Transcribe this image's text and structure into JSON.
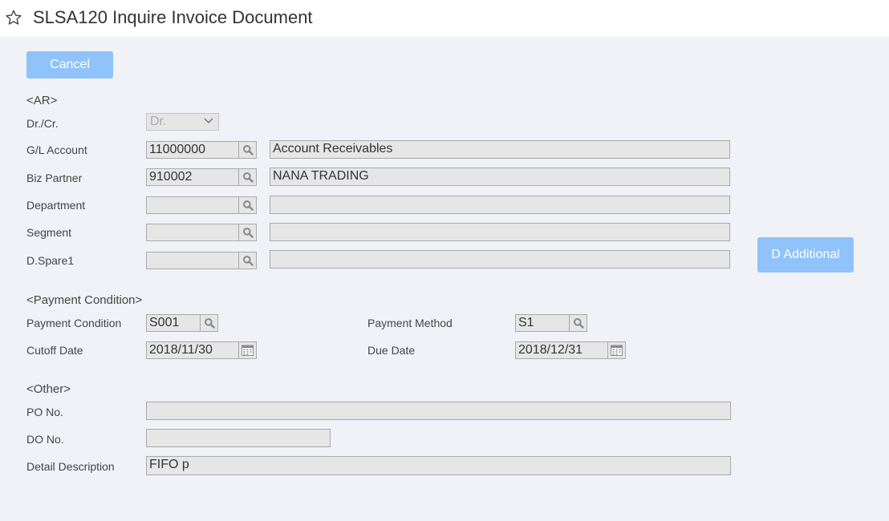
{
  "header": {
    "title": "SLSA120 Inquire Invoice Document"
  },
  "buttons": {
    "cancel": "Cancel",
    "d_additional": "D Additional"
  },
  "sections": {
    "ar": "<AR>",
    "payment": "<Payment Condition>",
    "other": "<Other>"
  },
  "ar": {
    "drcr_label": "Dr./Cr.",
    "drcr_value": "Dr.",
    "gl_label": "G/L Account",
    "gl_code": "11000000",
    "gl_name": "Account Receivables",
    "bp_label": "Biz Partner",
    "bp_code": "910002",
    "bp_name": "NANA TRADING",
    "dept_label": "Department",
    "dept_code": "",
    "dept_name": "",
    "seg_label": "Segment",
    "seg_code": "",
    "seg_name": "",
    "spare_label": "D.Spare1",
    "spare_code": "",
    "spare_name": ""
  },
  "payment": {
    "cond_label": "Payment Condition",
    "cond_value": "S001",
    "method_label": "Payment Method",
    "method_value": "S1",
    "cutoff_label": "Cutoff Date",
    "cutoff_value": "2018/11/30",
    "due_label": "Due Date",
    "due_value": "2018/12/31"
  },
  "other": {
    "po_label": "PO No.",
    "po_value": "",
    "do_label": "DO No.",
    "do_value": "",
    "desc_label": "Detail Description",
    "desc_value": "FIFO p"
  },
  "icons": {
    "star": "star-icon",
    "lookup": "magnifier-icon",
    "calendar": "calendar-icon",
    "dropdown": "chevron-down-icon"
  },
  "colors": {
    "button": "#8fc3f9",
    "panel": "#f0f2f7",
    "field": "#e6e6e6"
  }
}
